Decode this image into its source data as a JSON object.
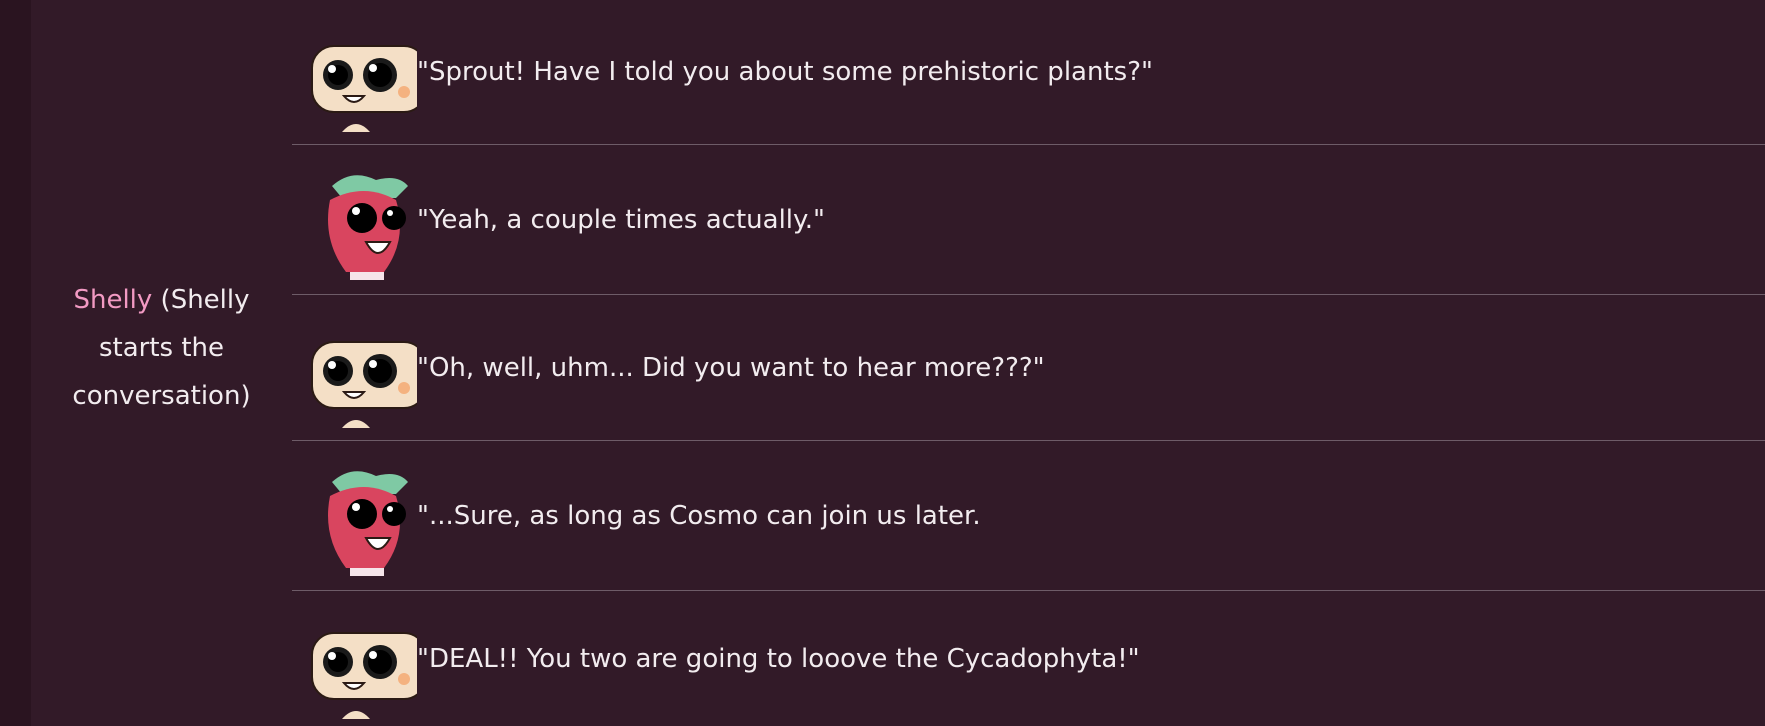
{
  "speaker": {
    "name": "Shelly",
    "note": "(Shelly starts the conversation)"
  },
  "dialogue": [
    {
      "character": "shelly",
      "text": "\"Sprout! Have I told you about some prehistoric plants?\""
    },
    {
      "character": "sprout",
      "text": "\"Yeah, a couple times actually.\""
    },
    {
      "character": "shelly",
      "text": "\"Oh, well, uhm... Did you want to hear more???\""
    },
    {
      "character": "sprout",
      "text": "\"...Sure, as long as Cosmo can join us later."
    },
    {
      "character": "shelly",
      "text": "\"DEAL!! You two are going to looove the Cycadophyta!\""
    }
  ],
  "colors": {
    "background": "#321a28",
    "outer": "#2a1420",
    "name_accent": "#f29ac3",
    "text": "#f2ecef",
    "divider": "#6e5c68"
  }
}
